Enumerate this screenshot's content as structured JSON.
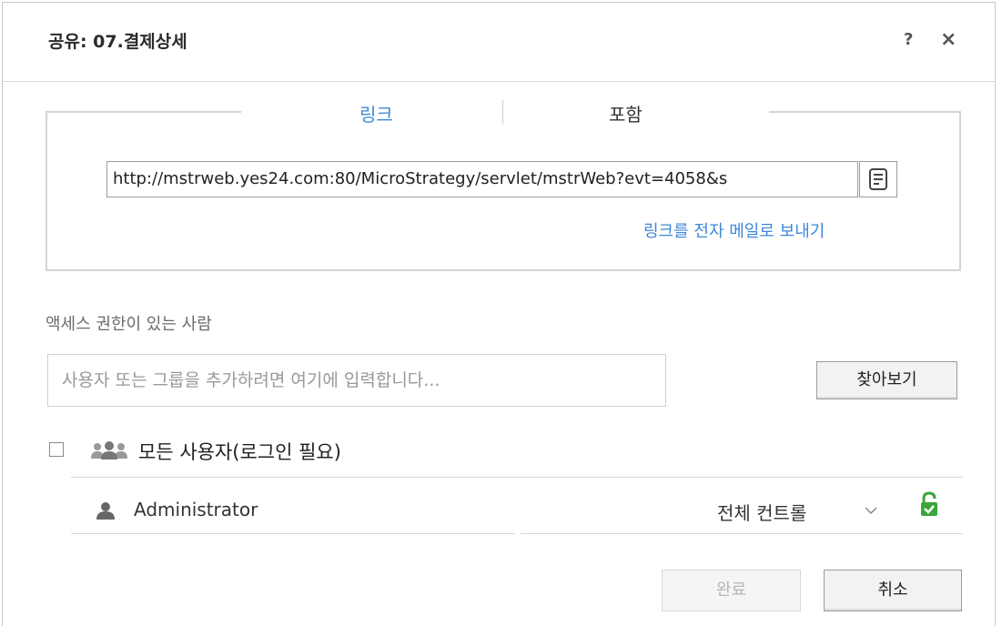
{
  "dialog": {
    "title": "공유: 07.결제상세",
    "help_label": "?",
    "close_label": "×"
  },
  "tabs": {
    "link_label": "링크",
    "embed_label": "포함"
  },
  "link": {
    "url": "http://mstrweb.yes24.com:80/MicroStrategy/servlet/mstrWeb?evt=4058&s",
    "email_link_label": "링크를 전자 메일로 보내기"
  },
  "access": {
    "label": "액세스 권한이 있는 사람",
    "input_placeholder": "사용자 또는 그룹을 추가하려면 여기에 입력합니다...",
    "browse_label": "찾아보기",
    "all_users_label": "모든 사용자(로그인 필요)",
    "all_users_checked": false
  },
  "users": [
    {
      "name": "Administrator",
      "permission": "전체 컨트롤"
    }
  ],
  "buttons": {
    "done_label": "완료",
    "cancel_label": "취소"
  },
  "colors": {
    "accent_link": "#3d87d8",
    "lock_green": "#3aa53a"
  }
}
